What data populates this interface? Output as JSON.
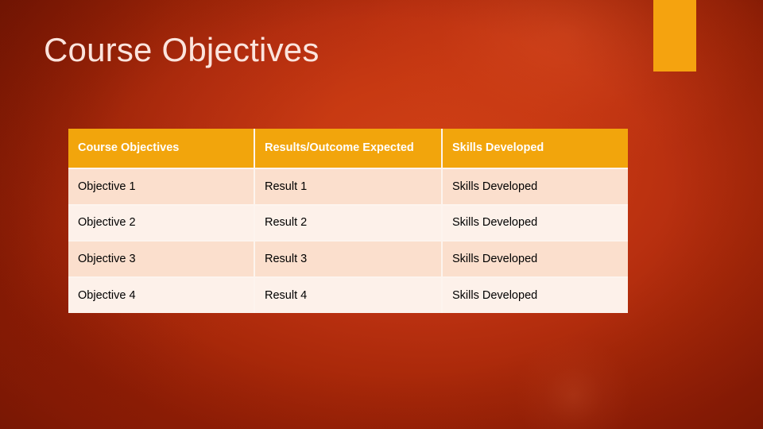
{
  "slide": {
    "title": "Course Objectives",
    "background_color": "#b93010",
    "accent_color": "#f5a30f",
    "title_color": "#fbe4dd"
  },
  "accent": {
    "name": "top-right-accent-rectangle",
    "color": "#f5a30f"
  },
  "table": {
    "header_background": "#f2a50c",
    "header_text_color": "#ffffff",
    "row_band_dark": "#fbdfcd",
    "row_band_light": "#fdf1ea",
    "body_text_color": "#000000",
    "columns": [
      "Course Objectives",
      "Results/Outcome Expected",
      "Skills Developed"
    ],
    "rows": [
      [
        "Objective 1",
        "Result 1",
        "Skills Developed"
      ],
      [
        "Objective 2",
        "Result 2",
        "Skills Developed"
      ],
      [
        "Objective 3",
        "Result 3",
        "Skills Developed"
      ],
      [
        "Objective 4",
        "Result 4",
        "Skills Developed"
      ]
    ]
  }
}
